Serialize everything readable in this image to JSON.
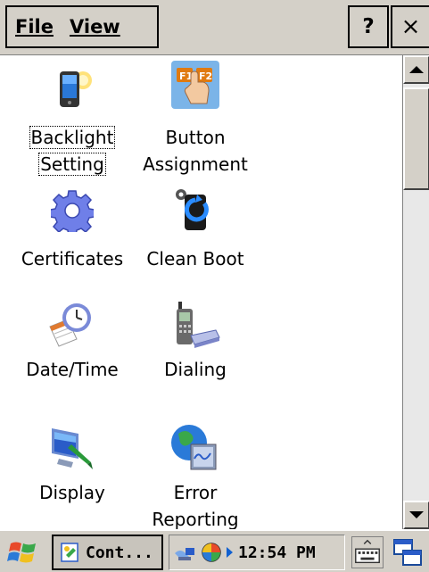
{
  "menubar": {
    "file_label": "File",
    "view_label": "View",
    "help_label": "?",
    "close_label": "×"
  },
  "items": [
    {
      "label_1": "Backlight",
      "label_2": "Setting",
      "icon": "backlight-icon",
      "selected": true
    },
    {
      "label_1": "Button",
      "label_2": "Assignment",
      "icon": "button-assignment-icon"
    },
    {
      "label_1": "Certificates",
      "icon": "certificates-icon"
    },
    {
      "label_1": "Clean Boot",
      "icon": "clean-boot-icon"
    },
    {
      "label_1": "Date/Time",
      "icon": "date-time-icon"
    },
    {
      "label_1": "Dialing",
      "icon": "dialing-icon"
    },
    {
      "label_1": "Display",
      "icon": "display-icon"
    },
    {
      "label_1": "Error",
      "label_2": "Reporting",
      "icon": "error-reporting-icon"
    }
  ],
  "taskbar": {
    "task_label": "Cont...",
    "clock": "12:54 PM",
    "start_icon": "windows-flag-icon",
    "keyboard_icon": "keyboard-icon",
    "desktop_icon": "switch-windows-icon"
  },
  "colors": {
    "chrome": "#d4d0c8",
    "scroll_track": "#e8e8e8"
  }
}
